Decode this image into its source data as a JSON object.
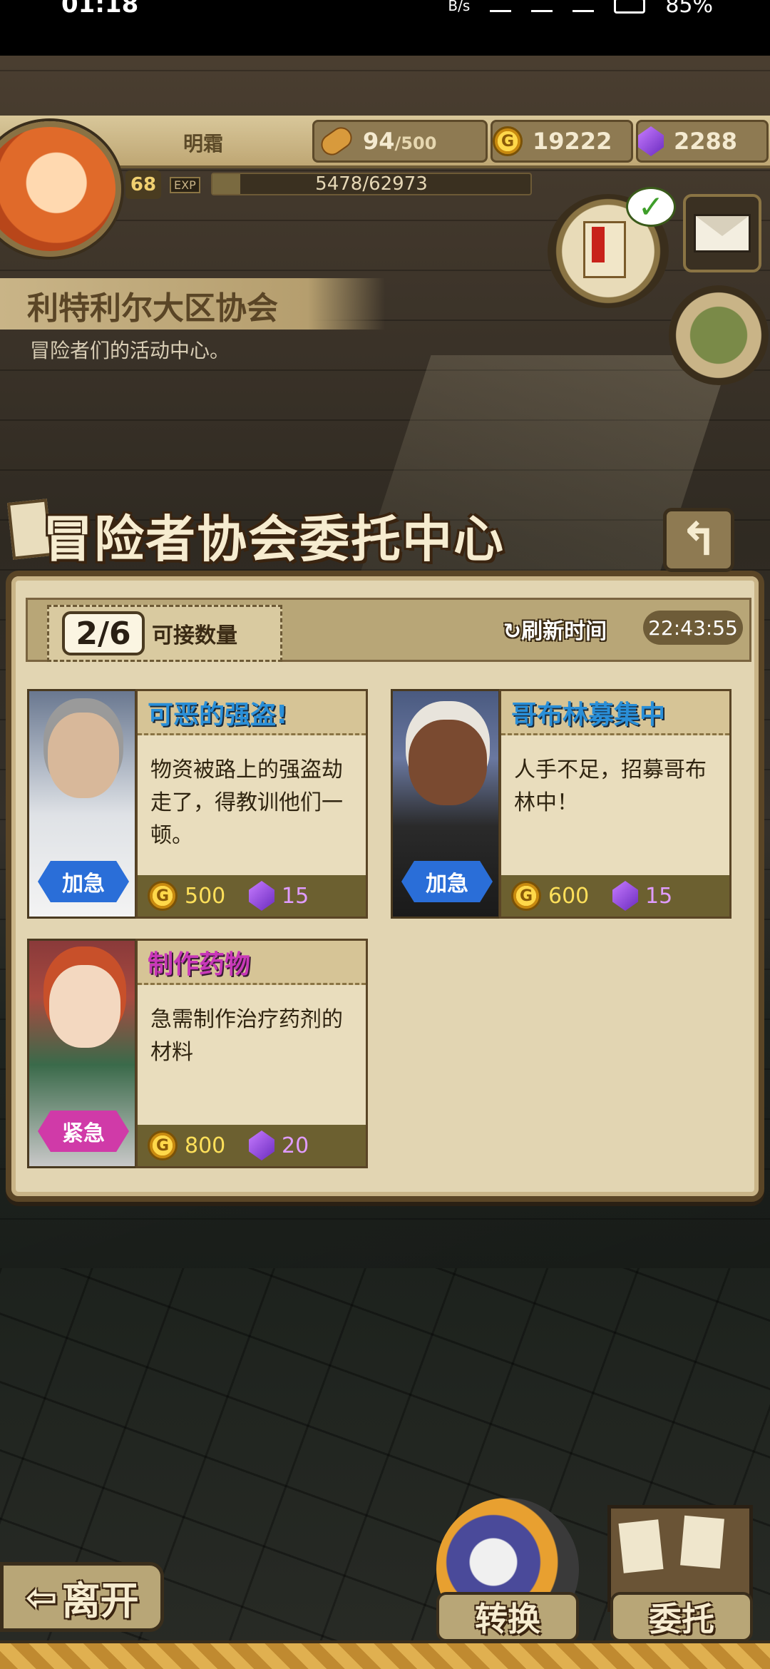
{
  "status_bar": {
    "time": "01:18",
    "net_speed": "B/s",
    "battery": "85%"
  },
  "player": {
    "name": "明霜",
    "level": "68",
    "exp_tag": "EXP",
    "exp_text": "5478/62973",
    "exp_fraction": 0.087,
    "stamina": "94",
    "stamina_max": "/500",
    "gold": "19222",
    "gems": "2288"
  },
  "location": {
    "title": "利特利尔大区协会",
    "description": "冒险者们的活动中心。"
  },
  "panel": {
    "title": "冒险者协会委托中心",
    "back_icon": "↰",
    "count": "2/6",
    "count_label": "可接数量",
    "refresh_label": "刷新时间",
    "refresh_time": "22:43:55"
  },
  "quests": [
    {
      "title": "可恶的强盗!",
      "description": "物资被路上的强盗劫走了，得教训他们一顿。",
      "badge": "加急",
      "gold": "500",
      "gems": "15"
    },
    {
      "title": "哥布林募集中",
      "description": "人手不足，招募哥布林中！",
      "badge": "加急",
      "gold": "600",
      "gems": "15"
    },
    {
      "title": "制作药物",
      "description": "急需制作治疗药剂的材料",
      "badge": "紧急",
      "gold": "800",
      "gems": "20"
    }
  ],
  "bottom": {
    "leave": "离开",
    "convert": "转换",
    "commission": "委托"
  },
  "icons": {
    "coin": "G",
    "check": "✓",
    "refresh": "↻",
    "arrow_left": "⇦"
  },
  "colors": {
    "urgent_blue": "#2a6ed8",
    "urgent_pink": "#d03aa8",
    "title_blue": "#2a8fd8",
    "title_purple": "#c838b8"
  }
}
